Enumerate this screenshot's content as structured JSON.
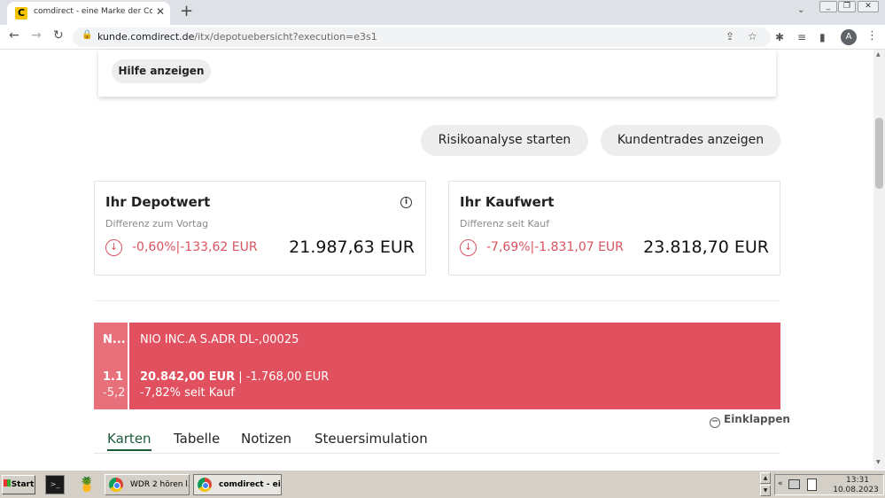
{
  "browser": {
    "tab_title": "comdirect - eine Marke der Commerzbank",
    "tab_favicon_letter": "C",
    "url_host": "kunde.comdirect.de",
    "url_path": "/itx/depotuebersicht?execution=e3s1",
    "avatar_letter": "A",
    "icons": [
      "back-icon",
      "forward-icon",
      "reload-icon",
      "lock-icon",
      "share-icon",
      "star-icon",
      "extensions-icon",
      "media-icon",
      "sidepanel-icon",
      "kebab-icon"
    ]
  },
  "page": {
    "help_button": "Hilfe anzeigen",
    "risk_button": "Risikoanalyse starten",
    "trades_button": "Kundentrades anzeigen",
    "depot_card": {
      "title": "Ihr Depotwert",
      "subtitle": "Differenz zum Vortag",
      "diff": "-0,60%|-133,62 EUR",
      "total": "21.987,63 EUR"
    },
    "kauf_card": {
      "title": "Ihr Kaufwert",
      "subtitle": "Differenz seit Kauf",
      "diff": "-7,69%|-1.831,07 EUR",
      "total": "23.818,70 EUR"
    },
    "position": {
      "stub_label": "N...",
      "stub_value": "1.1",
      "stub_pct": "-5,2",
      "name": "NIO INC.A S.ADR DL-,00025",
      "value": "20.842,00 EUR",
      "separator": " | ",
      "diff": "-1.768,00 EUR",
      "pct_since_buy": "-7,82% seit Kauf",
      "color": "#e0505e"
    },
    "collapse_label": "Einklappen",
    "tabs": [
      "Karten",
      "Tabelle",
      "Notizen",
      "Steuersimulation"
    ],
    "active_tab": "Karten",
    "negative_color": "#d9535f",
    "accent_color": "#1e5b3c"
  },
  "taskbar": {
    "start_label": "Start",
    "task_wdr": "WDR 2 hören l...",
    "task_comdirect": "comdirect - ei...",
    "time": "13:31",
    "date": "10.08.2023"
  }
}
